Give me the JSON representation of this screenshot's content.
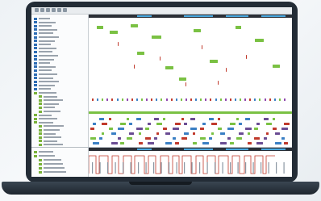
{
  "colors": {
    "bezel": "#232c36",
    "accent_green": "#7ac143",
    "accent_red": "#c0392b",
    "accent_blue": "#3a7fc4",
    "timeline_dark": "#2b2f36",
    "timeline_blue": "#4aa9e0",
    "trace_red": "#c0392b"
  },
  "toolbar": {
    "icons": [
      "back-icon",
      "forward-icon",
      "zoom-in-icon",
      "zoom-out-icon",
      "filter-icon",
      "search-icon"
    ]
  }
}
